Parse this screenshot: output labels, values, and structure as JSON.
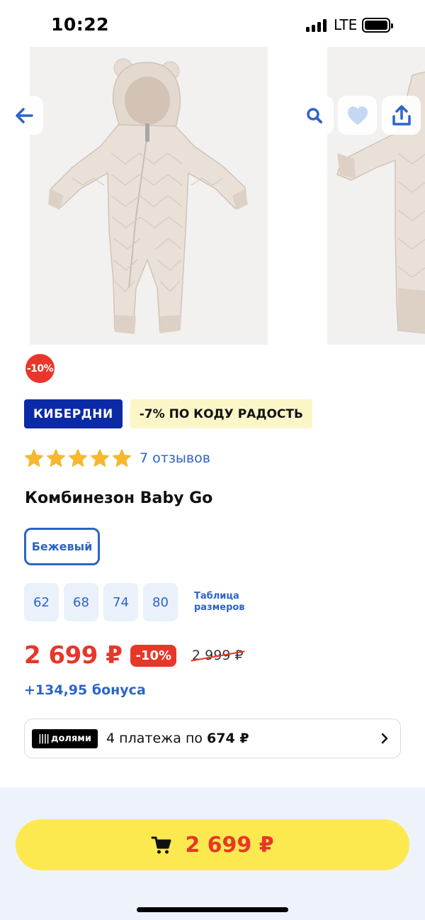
{
  "status_bar": {
    "time": "10:22",
    "network": "LTE"
  },
  "gallery": {
    "images": [
      "beige baby jumpsuit front view",
      "beige baby jumpsuit side view"
    ]
  },
  "icons": {
    "back": "arrow-left-icon",
    "search": "search-icon",
    "favorite": "heart-icon",
    "share": "share-icon",
    "cart": "cart-icon",
    "chevron": "chevron-right-icon"
  },
  "product": {
    "discount_badge": "-10%",
    "promo_primary": "КИБЕРДНИ",
    "promo_secondary": "-7% ПО КОДУ РАДОСТЬ",
    "rating_stars": 5,
    "reviews_label": "7 отзывов",
    "title": "Комбинезон Baby Go",
    "color": "Бежевый",
    "sizes": [
      "62",
      "68",
      "74",
      "80"
    ],
    "size_table_label": "Таблица размеров",
    "price": "2 699 ₽",
    "price_discount": "-10%",
    "old_price": "2 999 ₽",
    "bonus": "+134,95 бонуса"
  },
  "installments": {
    "provider": "долями",
    "text_prefix": "4 платежа по",
    "amount": "674 ₽"
  },
  "cart_button": {
    "price": "2 699 ₽"
  },
  "colors": {
    "brand_blue": "#2d64c8",
    "promo_blue": "#0a2aa6",
    "sale_red": "#e8362a",
    "cart_yellow": "#fce94f",
    "star_gold": "#f5b82e"
  }
}
